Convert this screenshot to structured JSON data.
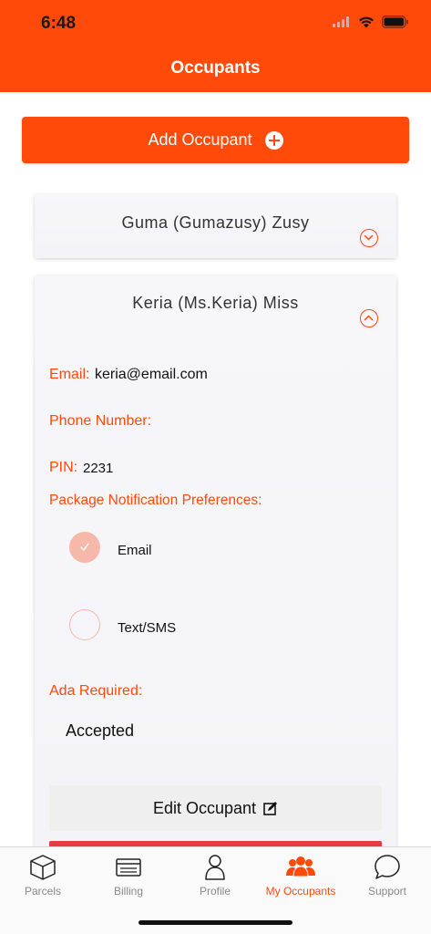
{
  "status_bar": {
    "time": "6:48"
  },
  "header": {
    "title": "Occupants"
  },
  "add_button": {
    "label": "Add Occupant"
  },
  "occupants": [
    {
      "name": "Guma (Gumazusy) Zusy",
      "expanded": false
    },
    {
      "name": "Keria (Ms.Keria) Miss",
      "expanded": true,
      "email_label": "Email:",
      "email_value": "keria@email.com",
      "phone_label": "Phone Number:",
      "phone_value": "",
      "pin_label": "PIN:",
      "pin_value": "2231",
      "prefs_label": "Package Notification Preferences:",
      "prefs": [
        {
          "label": "Email",
          "checked": true
        },
        {
          "label": "Text/SMS",
          "checked": false
        }
      ],
      "ada_label": "Ada Required:",
      "ada_value": "Accepted",
      "edit_label": "Edit Occupant"
    }
  ],
  "tabs": [
    {
      "label": "Parcels",
      "icon": "box-icon",
      "active": false
    },
    {
      "label": "Billing",
      "icon": "billing-card-icon",
      "active": false
    },
    {
      "label": "Profile",
      "icon": "person-icon",
      "active": false
    },
    {
      "label": "My Occupants",
      "icon": "group-icon",
      "active": true
    },
    {
      "label": "Support",
      "icon": "chat-bubble-icon",
      "active": false
    }
  ],
  "colors": {
    "accent": "#ff4a0a",
    "delete": "#ec3b3b",
    "radio_checked": "#f6b8a8"
  }
}
